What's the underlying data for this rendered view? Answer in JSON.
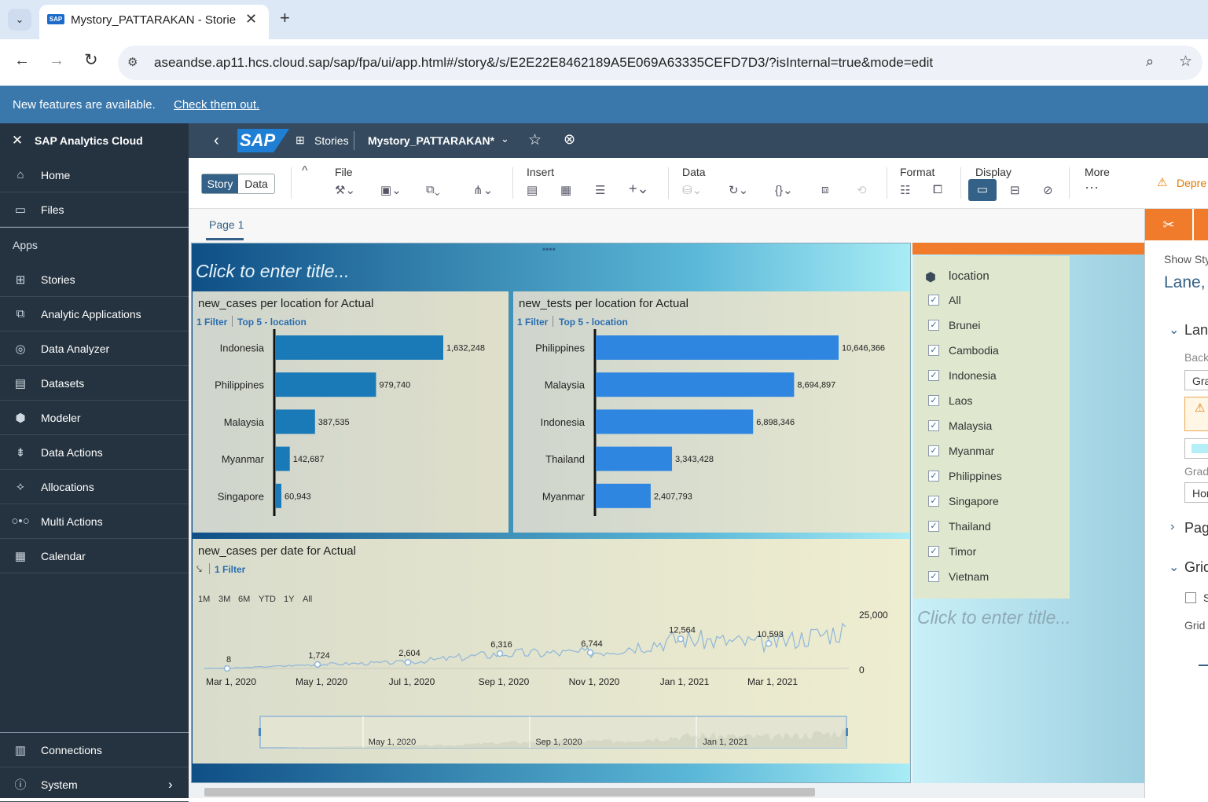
{
  "browser": {
    "tab_title": "Mystory_PATTARAKAN - Stories",
    "url": "aseandse.ap11.hcs.cloud.sap/sap/fpa/ui/app.html#/story&/s/E2E22E8462189A5E069A63335CEFD7D3/?isInternal=true&mode=edit"
  },
  "banner": {
    "text": "New features are available.",
    "link": "Check them out."
  },
  "sidebar": {
    "title": "SAP Analytics Cloud",
    "top_items": [
      {
        "label": "Home",
        "icon": "home-icon"
      },
      {
        "label": "Files",
        "icon": "folder-icon"
      }
    ],
    "apps_heading": "Apps",
    "items": [
      {
        "label": "Stories",
        "icon": "stories-icon"
      },
      {
        "label": "Analytic Applications",
        "icon": "analytic-applications-icon"
      },
      {
        "label": "Data Analyzer",
        "icon": "data-analyzer-icon"
      },
      {
        "label": "Datasets",
        "icon": "datasets-icon"
      },
      {
        "label": "Modeler",
        "icon": "modeler-icon"
      },
      {
        "label": "Data Actions",
        "icon": "data-actions-icon"
      },
      {
        "label": "Allocations",
        "icon": "allocations-icon"
      },
      {
        "label": "Multi Actions",
        "icon": "multi-actions-icon"
      },
      {
        "label": "Calendar",
        "icon": "calendar-icon"
      }
    ],
    "bottom_items": [
      {
        "label": "Connections",
        "icon": "connections-icon"
      },
      {
        "label": "System",
        "icon": "system-icon"
      }
    ]
  },
  "shell": {
    "logo": "SAP",
    "stories": "Stories",
    "story_name": "Mystory_PATTARAKAN*"
  },
  "toolbar": {
    "story_toggle": "Story",
    "data_toggle": "Data",
    "file": "File",
    "insert": "Insert",
    "data": "Data",
    "format": "Format",
    "display": "Display",
    "more": "More",
    "deprecated": "Depre"
  },
  "page_tab": "Page 1",
  "title_placeholder": "Click to enter title...",
  "chart1": {
    "title": "new_cases per location for Actual",
    "filter": "1 Filter",
    "topn": "Top 5 - location",
    "categories": [
      "Indonesia",
      "Philippines",
      "Malaysia",
      "Myanmar",
      "Singapore"
    ],
    "labels": [
      "1,632,248",
      "979,740",
      "387,535",
      "142,687",
      "60,943"
    ]
  },
  "chart2": {
    "title": "new_tests per location for Actual",
    "filter": "1 Filter",
    "topn": "Top 5 - location",
    "categories": [
      "Philippines",
      "Malaysia",
      "Indonesia",
      "Thailand",
      "Myanmar"
    ],
    "labels": [
      "10,646,366",
      "8,694,897",
      "6,898,346",
      "3,343,428",
      "2,407,793"
    ]
  },
  "chart3": {
    "title": "new_cases per date for Actual",
    "filter": "1 Filter",
    "range_buttons": [
      "1M",
      "3M",
      "6M",
      "YTD",
      "1Y",
      "All"
    ],
    "y_ticks": [
      "25,000",
      "0"
    ],
    "x_ticks": [
      "Mar 1, 2020",
      "May 1, 2020",
      "Jul 1, 2020",
      "Sep 1, 2020",
      "Nov 1, 2020",
      "Jan 1, 2021",
      "Mar 1, 2021"
    ],
    "point_labels": [
      "8",
      "1,724",
      "2,604",
      "6,316",
      "6,744",
      "12,564",
      "10,593"
    ],
    "navigator_ticks": [
      "May 1, 2020",
      "Sep 1, 2020",
      "Jan 1, 2021"
    ]
  },
  "chart_data": [
    {
      "type": "bar",
      "title": "new_cases per location for Actual",
      "categories": [
        "Indonesia",
        "Philippines",
        "Malaysia",
        "Myanmar",
        "Singapore"
      ],
      "values": [
        1632248,
        979740,
        387535,
        142687,
        60943
      ]
    },
    {
      "type": "bar",
      "title": "new_tests per location for Actual",
      "categories": [
        "Philippines",
        "Malaysia",
        "Indonesia",
        "Thailand",
        "Myanmar"
      ],
      "values": [
        10646366,
        8694897,
        6898346,
        3343428,
        2407793
      ]
    },
    {
      "type": "line",
      "title": "new_cases per date for Actual",
      "x": [
        "Mar 1, 2020",
        "May 1, 2020",
        "Jul 1, 2020",
        "Sep 1, 2020",
        "Nov 1, 2020",
        "Jan 1, 2021",
        "Mar 1, 2021"
      ],
      "values": [
        8,
        1724,
        2604,
        6316,
        6744,
        12564,
        10593
      ],
      "ylim": [
        0,
        25000
      ]
    }
  ],
  "filter_panel": {
    "title": "location",
    "items": [
      "All",
      "Brunei",
      "Cambodia",
      "Indonesia",
      "Laos",
      "Malaysia",
      "Myanmar",
      "Philippines",
      "Singapore",
      "Thailand",
      "Timor",
      "Vietnam"
    ]
  },
  "right_panel": {
    "show_style": "Show Sty",
    "lane": "Lane,",
    "lane_section": "Lan",
    "back_label": "Back",
    "gra_value": "Gra",
    "grad_label": "Grad",
    "hor_value": "Hor",
    "page_section": "Pag",
    "grid_section": "Grid",
    "grid_check": "S",
    "grid_label": "Grid"
  },
  "colors": {
    "bar1": "#1a7ab8",
    "bar2": "#2e86e0",
    "shell": "#354a5f",
    "sidebar": "#253340",
    "accent": "#f07b2a"
  }
}
